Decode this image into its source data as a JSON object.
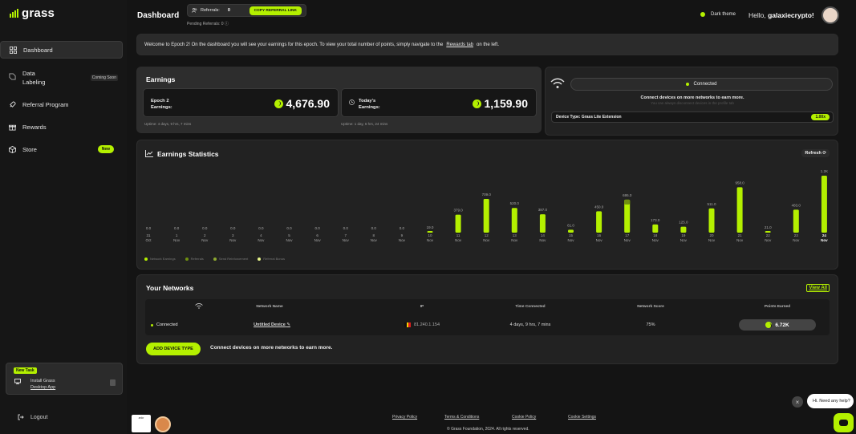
{
  "brand": {
    "name": "grass",
    "accent": "#b4f000",
    "dark": "#141414"
  },
  "sidebar": {
    "items": [
      {
        "label": "Dashboard",
        "icon": "grid-icon"
      },
      {
        "label": "Data",
        "label2": "Labeling",
        "badge": "Coming Soon",
        "icon": "tag-icon"
      },
      {
        "label": "Referral Program",
        "icon": "rocket-icon"
      },
      {
        "label": "Rewards",
        "icon": "gift-icon"
      },
      {
        "label": "Store",
        "badge": "New",
        "icon": "cube-icon"
      }
    ],
    "task": {
      "badge": "New Task",
      "line1": "Install Grass",
      "line2": "Desktop App"
    },
    "logout": "Logout"
  },
  "header": {
    "title": "Dashboard",
    "referrals_label": "Referrals:",
    "referrals_count": "0",
    "copy_label": "COPY REFERRAL LINK",
    "pending": "Pending Referrals: 0",
    "theme_label": "Dark theme",
    "hello": "Hello,",
    "username": "galaxiecrypto!"
  },
  "welcome": {
    "text": "Welcome to Epoch 2! On the dashboard you will see your earnings for this epoch. To view your total number of points, simply navigate to the",
    "link": "Rewards tab",
    "suffix": "on the left."
  },
  "earnings": {
    "title": "Earnings",
    "epoch_label1": "Epoch 2",
    "epoch_label2": "Earnings:",
    "epoch_value": "4,676.90",
    "epoch_uptime": "Uptime: 4 days, 9 hrs, 7 mins",
    "today_label1": "Today's",
    "today_label2": "Earnings:",
    "today_value": "1,159.90",
    "today_uptime": "Uptime: 1 day, 6 hrs, 24 mins"
  },
  "connection": {
    "status": "Connected",
    "message": "Connect devices on more networks to earn more.",
    "sub": "You can always disconnect devices in the profile tab",
    "device": "Device Type: Grass Lite Extension",
    "multiplier": "1.00x"
  },
  "stats": {
    "title": "Earnings Statistics",
    "refresh": "Refresh",
    "legend": [
      "Network Earnings",
      "Referrals",
      "Send Reinforcement",
      "Referral Bonus"
    ]
  },
  "chart_data": {
    "type": "bar",
    "title": "Earnings Statistics",
    "categories": [
      "31 Oct",
      "1 Nov",
      "2 Nov",
      "3 Nov",
      "4 Nov",
      "5 Nov",
      "6 Nov",
      "7 Nov",
      "8 Nov",
      "9 Nov",
      "10 Nov",
      "11 Nov",
      "12 Nov",
      "13 Nov",
      "14 Nov",
      "15 Nov",
      "16 Nov",
      "17 Nov",
      "18 Nov",
      "19 Nov",
      "20 Nov",
      "21 Nov",
      "22 Nov",
      "23 Nov",
      "24 Nov"
    ],
    "day_labels": [
      "31",
      "1",
      "2",
      "3",
      "4",
      "5",
      "6",
      "7",
      "8",
      "9",
      "10",
      "11",
      "12",
      "13",
      "14",
      "15",
      "16",
      "17",
      "18",
      "19",
      "20",
      "21",
      "22",
      "23",
      "24"
    ],
    "month_labels": [
      "Oct",
      "Nov",
      "Nov",
      "Nov",
      "Nov",
      "Nov",
      "Nov",
      "Nov",
      "Nov",
      "Nov",
      "Nov",
      "Nov",
      "Nov",
      "Nov",
      "Nov",
      "Nov",
      "Nov",
      "Nov",
      "Nov",
      "Nov",
      "Nov",
      "Nov",
      "Nov",
      "Nov",
      "Nov"
    ],
    "values": [
      0,
      0,
      0,
      0,
      0,
      0,
      0,
      0,
      0,
      0,
      19.0,
      379.0,
      709.0,
      520.0,
      387.0,
      61.0,
      450.0,
      695.0,
      173.0,
      125.0,
      511.0,
      958.0,
      21.0,
      483.0,
      1200
    ],
    "value_labels": [
      "0.0",
      "0.0",
      "0.0",
      "0.0",
      "0.0",
      "0.0",
      "0.0",
      "0.0",
      "0.0",
      "0.0",
      "19.0",
      "379.0",
      "709.0",
      "520.0",
      "387.0",
      "61.0",
      "450.0",
      "695.0",
      "173.0",
      "125.0",
      "511.0",
      "958.0",
      "21.0",
      "483.0",
      "1.2K"
    ],
    "ylim": [
      0,
      1200
    ],
    "grid": false,
    "legend_position": "bottom-left",
    "colors": {
      "bar": "#b4f000",
      "alt": "#6f8f10"
    }
  },
  "networks": {
    "title": "Your Networks",
    "view_all": "View All",
    "columns": [
      "",
      "Network Name",
      "IP",
      "Time Connected",
      "Network Score",
      "Points Earned"
    ],
    "row": {
      "status": "Connected",
      "name": "Untitled Device",
      "ip": "81.240.1.154",
      "time": "4 days, 9 hrs, 7 mins",
      "score": "75%",
      "points": "6.72K"
    },
    "add_button": "ADD DEVICE TYPE",
    "add_message": "Connect devices on more networks to earn more."
  },
  "footer": {
    "links": [
      "Privacy Policy",
      "Terms & Conditions",
      "Cookie Policy",
      "Cookie Settings"
    ],
    "copyright": "© Grass Foundation, 2024. All rights reserved.",
    "badge1": "ankr"
  },
  "help": {
    "bubble": "Hi. Need any help?",
    "close": "×"
  }
}
